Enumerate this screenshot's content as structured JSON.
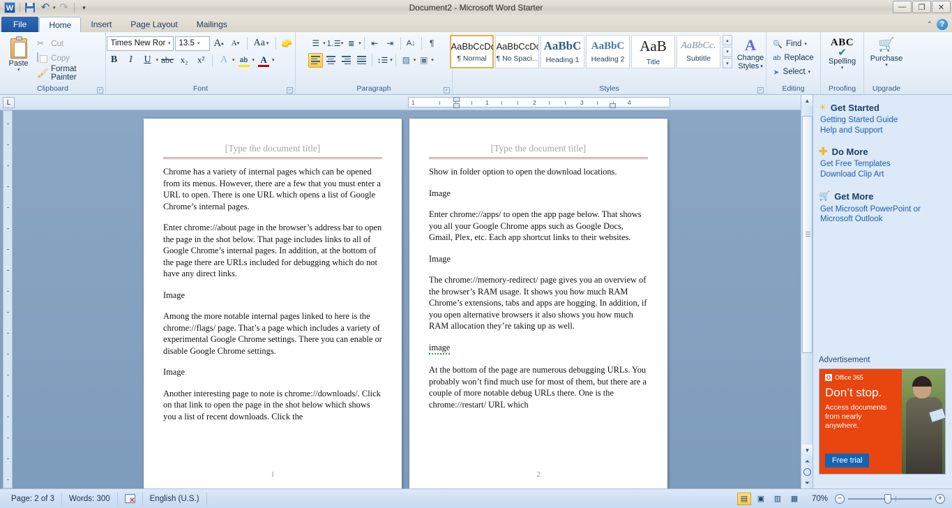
{
  "window": {
    "title": "Document2  -  Microsoft Word Starter",
    "minimize": "—",
    "restore": "❐",
    "close": "✕"
  },
  "quick_access": {
    "word_logo": "W",
    "save": "save-icon",
    "undo": "↶",
    "redo": "↷",
    "customize": "▾"
  },
  "tabs": [
    {
      "label": "File"
    },
    {
      "label": "Home"
    },
    {
      "label": "Insert"
    },
    {
      "label": "Page Layout"
    },
    {
      "label": "Mailings"
    }
  ],
  "help": {
    "collapse": "⌃",
    "question": "?"
  },
  "ribbon": {
    "clipboard": {
      "label": "Clipboard",
      "paste": "Paste",
      "paste_caret": "▾",
      "cut": "Cut",
      "copy": "Copy",
      "format_painter": "Format Painter"
    },
    "font": {
      "label": "Font",
      "font_name": "Times New Rom",
      "font_size": "13.5",
      "grow_font": "A",
      "shrink_font": "A",
      "change_case": "Aa",
      "clear_formatting": "clear-formatting-icon",
      "bold": "B",
      "italic": "I",
      "underline": "U",
      "strikethrough": "abc",
      "subscript": "x₂",
      "superscript": "x²",
      "text_effects": "A",
      "highlight": "ab",
      "font_color": "A",
      "caret": "▾"
    },
    "paragraph": {
      "label": "Paragraph",
      "bullets": "bullets-icon",
      "numbering": "numbering-icon",
      "multilevel": "multilevel-list-icon",
      "decrease_indent": "decrease-indent-icon",
      "increase_indent": "increase-indent-icon",
      "sort": "sort-icon",
      "show_marks": "¶",
      "align_left": "align-left-icon",
      "align_center": "align-center-icon",
      "align_right": "align-right-icon",
      "justify": "justify-icon",
      "line_spacing": "line-spacing-icon",
      "shading": "shading-icon",
      "borders": "borders-icon",
      "caret": "▾"
    },
    "styles": {
      "label": "Styles",
      "items": [
        {
          "sample": "AaBbCcDc",
          "name": "¶ Normal",
          "selected": true
        },
        {
          "sample": "AaBbCcDc",
          "name": "¶ No Spaci...",
          "selected": false
        },
        {
          "sample": "AaBbC",
          "name": "Heading 1",
          "selected": false
        },
        {
          "sample": "AaBbC",
          "name": "Heading 2",
          "selected": false
        },
        {
          "sample": "AaB",
          "name": "Title",
          "selected": false
        },
        {
          "sample": "AaBbCc.",
          "name": "Subtitle",
          "selected": false
        }
      ],
      "gallery_up": "▴",
      "gallery_down": "▾",
      "gallery_more": "▾",
      "change_styles": "Change",
      "change_styles2": "Styles",
      "change_caret": "▾"
    },
    "editing": {
      "label": "Editing",
      "find": "Find",
      "replace": "Replace",
      "select": "Select",
      "caret": "▾"
    },
    "proofing": {
      "label": "Proofing",
      "spelling_abc": "ABC",
      "spelling": "Spelling",
      "caret": "▾"
    },
    "upgrade": {
      "label": "Upgrade",
      "purchase": "Purchase",
      "caret": "▾"
    }
  },
  "ruler": {
    "corner_tab": "L",
    "marks": [
      "1",
      "1",
      "2",
      "3",
      "4"
    ]
  },
  "document": {
    "pages": [
      {
        "title": "[Type the document title]",
        "page_number": "1",
        "paragraphs": [
          "Chrome has a variety of internal pages which can be opened from its menus. However, there are a few that you must enter a URL to open. There is one URL which opens a list of Google Chrome’s internal pages.",
          "Enter chrome://about page in the browser’s address bar to open the page in the shot below. That page includes links to all of Google Chrome’s internal pages. In addition, at the bottom of the page there are URLs included for debugging which do not have any direct links.",
          "Image",
          "Among the more notable internal pages linked to here is the chrome://flags/ page. That’s a page which includes a variety of experimental Google Chrome settings. There you can enable or disable Google Chrome settings.",
          "Image",
          "Another interesting page to note is chrome://downloads/. Click on that link to open the page in the shot below which shows you a list of recent downloads. Click the"
        ]
      },
      {
        "title": "[Type the document title]",
        "page_number": "2",
        "paragraphs": [
          "Show in folder option to open the download locations.",
          "Image",
          "Enter chrome://apps/ to open the app page below. That shows you all your Google Chrome apps such as Google Docs, Gmail, Plex, etc. Each app shortcut links to their websites.",
          "Image",
          "The chrome://memory-redirect/ page gives you an overview of the browser’s RAM usage. It shows you how much RAM Chrome’s extensions, tabs and apps are hogging. In addition, if you open alternative browsers it also shows you how much RAM allocation they’re taking up as well.",
          "image",
          "At the bottom of the page are numerous debugging URLs. You probably won’t find much use for most of them, but there are a couple of more notable debug URLs there. One is the chrome://restart/ URL which"
        ]
      }
    ]
  },
  "sidebar": {
    "sections": [
      {
        "icon": "sparkle-icon",
        "heading": "Get Started",
        "links": [
          "Getting Started Guide",
          "Help and Support"
        ]
      },
      {
        "icon": "plus-icon",
        "heading": "Do More",
        "links": [
          "Get Free Templates",
          "Download Clip Art"
        ]
      },
      {
        "icon": "cart-icon",
        "heading": "Get More",
        "links": [
          "Get Microsoft PowerPoint or Microsoft Outlook"
        ]
      }
    ],
    "advertisement_label": "Advertisement",
    "ad": {
      "brand": "Office 365",
      "brand_mark": "O",
      "headline": "Don’t stop.",
      "body": "Access documents from nearly anywhere.",
      "button": "Free trial",
      "accent_color": "#e8450f",
      "button_color": "#1464b4"
    }
  },
  "status_bar": {
    "page": "Page: 2 of 3",
    "words": "Words: 300",
    "proofing_icon": "proofing-errors-icon",
    "language": "English (U.S.)",
    "views": {
      "print_layout": "print-layout-icon",
      "full_screen_reading": "full-screen-reading-icon",
      "web_layout": "web-layout-icon",
      "draft": "draft-icon"
    },
    "zoom": "70%",
    "zoom_out": "−",
    "zoom_in": "+"
  }
}
